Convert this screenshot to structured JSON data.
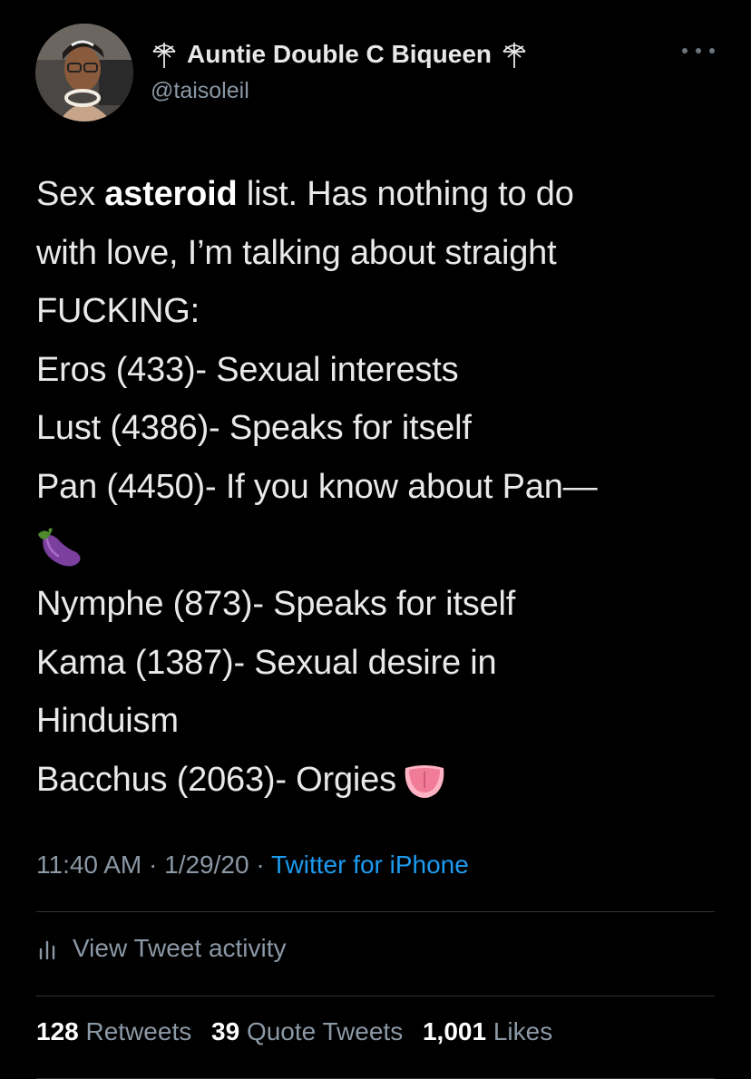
{
  "author": {
    "display_name": "Auntie Double C Biqueen",
    "handle": "@taisoleil",
    "name_icon_left": "wheel-glyph-icon",
    "name_icon_right": "wheel-glyph-icon"
  },
  "tweet": {
    "lines": [
      {
        "pre": "Sex ",
        "bold": "asteroid",
        "post": " list. Has nothing to do"
      },
      {
        "text": "with love, I’m talking about straight"
      },
      {
        "text": "FUCKING:"
      },
      {
        "text": "Eros (433)- Sexual interests"
      },
      {
        "text": "Lust (4386)- Speaks for itself"
      },
      {
        "text": "Pan (4450)- If you know about Pan—"
      },
      {
        "emoji": "eggplant-emoji"
      },
      {
        "text": "Nymphe (873)- Speaks for itself"
      },
      {
        "text": "Kama (1387)- Sexual desire in"
      },
      {
        "text": "Hinduism"
      },
      {
        "text": "Bacchus (2063)- Orgies",
        "emoji": "tongue-emoji"
      }
    ]
  },
  "meta": {
    "time": "11:40 AM",
    "sep1": " · ",
    "date": "1/29/20",
    "sep2": " · ",
    "source": "Twitter for iPhone"
  },
  "activity": {
    "label": "View Tweet activity"
  },
  "stats": {
    "retweets_count": "128",
    "retweets_label": "Retweets",
    "quotes_count": "39",
    "quotes_label": "Quote Tweets",
    "likes_count": "1,001",
    "likes_label": "Likes"
  },
  "colors": {
    "background": "#000000",
    "text": "#e9e9e9",
    "secondary": "#8b98a5",
    "link": "#1d9bf0",
    "divider": "#2f3336"
  }
}
